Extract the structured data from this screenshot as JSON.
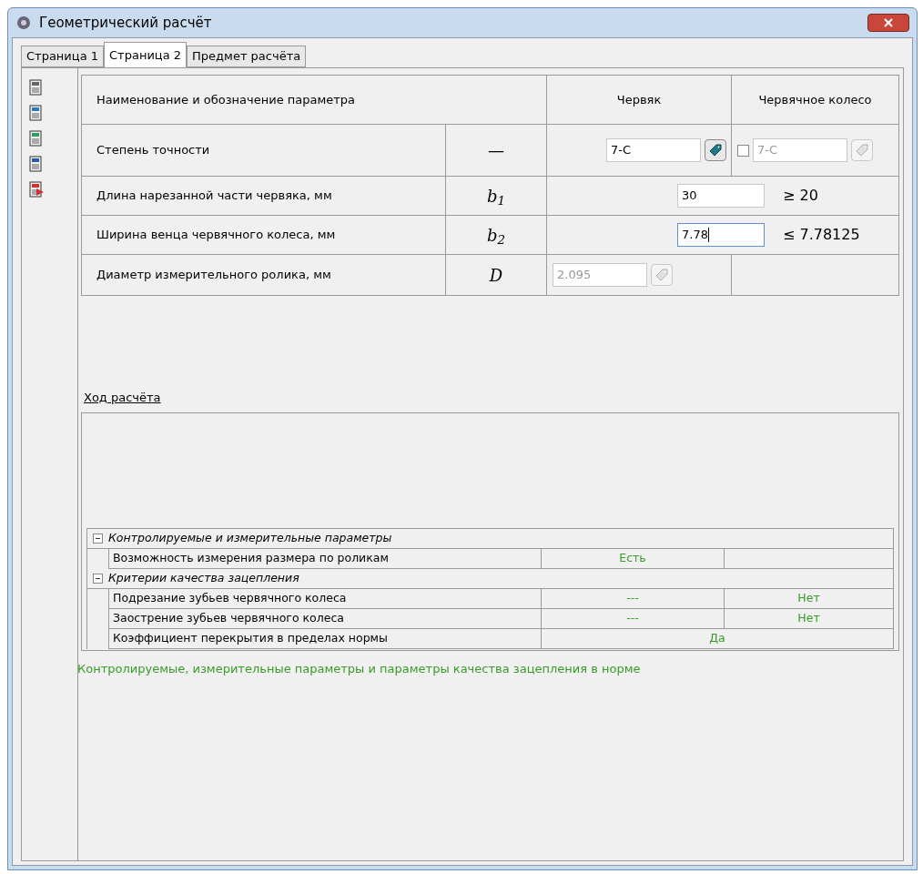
{
  "window": {
    "title": "Геометрический расчёт"
  },
  "tabs": [
    {
      "label": "Страница 1",
      "selected": false
    },
    {
      "label": "Страница 2",
      "selected": true
    },
    {
      "label": "Предмет расчёта",
      "selected": false
    }
  ],
  "table": {
    "columns": [
      "Наименование и обозначение параметра",
      "Червяк",
      "Червячное колесо"
    ],
    "rows": [
      {
        "kind": "select",
        "name": "Степень точности",
        "symbol": "—",
        "worm": {
          "value": "7-С",
          "disabled": false
        },
        "wheel": {
          "checked": false,
          "value": "7-С",
          "disabled": true
        }
      },
      {
        "kind": "span_input",
        "name": "Длина нарезанной части червяка, мм",
        "symbol": "b$_{1}$",
        "value": "30",
        "focused": false,
        "limit": "≥ 20"
      },
      {
        "kind": "span_input",
        "name": "Ширина венца червячного колеса, мм",
        "symbol": "b$_{2}$",
        "value": "7.78",
        "focused": true,
        "limit": "≤ 7.78125"
      },
      {
        "kind": "readonly",
        "name": "Диаметр измерительного ролика, мм",
        "symbol": "D",
        "worm": {
          "value": "2.095",
          "disabled": true
        }
      }
    ]
  },
  "progress_link": "Ход расчёта",
  "results": [
    {
      "group": "Контролируемые и измерительные параметры",
      "expanded": true,
      "children": [
        {
          "kind": "split",
          "name": "Возможность измерения размера по роликам",
          "worm": "Есть"
        }
      ]
    },
    {
      "group": "Критерии качества зацепления",
      "expanded": true,
      "children": [
        {
          "kind": "split",
          "name": "Подрезание зубьев червячного колеса",
          "worm": "---",
          "wheel": "Нет"
        },
        {
          "kind": "split",
          "name": "Заострение зубьев червячного колеса",
          "worm": "---",
          "wheel": "Нет"
        },
        {
          "kind": "merged",
          "name": "Коэффициент перекрытия в пределах нормы",
          "value": "Да"
        }
      ]
    }
  ],
  "summary": "Контролируемые, измерительные параметры и параметры качества зацепления в норме"
}
